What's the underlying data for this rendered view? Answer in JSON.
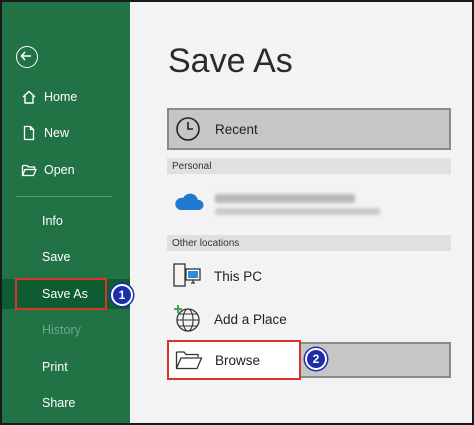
{
  "sidebar": {
    "items": [
      {
        "label": "Home"
      },
      {
        "label": "New"
      },
      {
        "label": "Open"
      },
      {
        "label": "Info"
      },
      {
        "label": "Save"
      },
      {
        "label": "Save As"
      },
      {
        "label": "History"
      },
      {
        "label": "Print"
      },
      {
        "label": "Share"
      }
    ],
    "accent_color": "#217346"
  },
  "main": {
    "title": "Save As",
    "recent_label": "Recent",
    "sections": {
      "personal": "Personal",
      "other": "Other locations"
    },
    "onedrive": {
      "name": "OneDrive - Personal",
      "email": "obscured email address"
    },
    "locations": {
      "this_pc": "This PC",
      "add_place": "Add a Place",
      "browse": "Browse"
    }
  },
  "annotations": {
    "step1": "1",
    "step2": "2",
    "highlight_color": "#d9342b",
    "badge_color": "#1c2fa8"
  },
  "icons": [
    "back-arrow-icon",
    "home-icon",
    "new-document-icon",
    "open-folder-icon",
    "clock-icon",
    "onedrive-cloud-icon",
    "this-pc-icon",
    "globe-add-icon",
    "folder-icon"
  ]
}
